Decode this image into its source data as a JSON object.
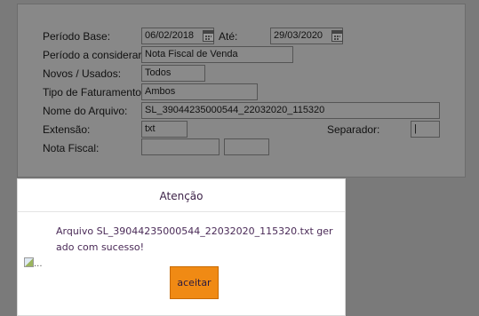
{
  "form": {
    "periodo_base_label": "Período Base:",
    "periodo_base_value": "06/02/2018",
    "ate_label": "Até:",
    "ate_value": "29/03/2020",
    "periodo_considerar_label": "Período a considerar:",
    "periodo_considerar_value": "Nota Fiscal de Venda",
    "novos_usados_label": "Novos / Usados:",
    "novos_usados_value": "Todos",
    "tipo_faturamento_label": "Tipo de Faturamento:",
    "tipo_faturamento_value": "Ambos",
    "nome_arquivo_label": "Nome do Arquivo:",
    "nome_arquivo_value": "SL_39044235000544_22032020_115320",
    "extensao_label": "Extensão:",
    "extensao_value": "txt",
    "separador_label": "Separador:",
    "separador_value": "|",
    "nota_fiscal_label": "Nota Fiscal:",
    "nota_fiscal_value_1": "",
    "nota_fiscal_value_2": ""
  },
  "dialog": {
    "title": "Atenção",
    "message": "Arquivo SL_39044235000544_22032020_115320.txt gerado com sucesso!",
    "broken_image_text": "...",
    "accept_label": "aceitar"
  },
  "icons": {
    "calendar": "calendar-icon",
    "broken_image": "broken-image-icon"
  },
  "colors": {
    "accept_button": "#f08a14",
    "dialog_text": "#4a2a57",
    "overlay": "#7a7a7a"
  }
}
